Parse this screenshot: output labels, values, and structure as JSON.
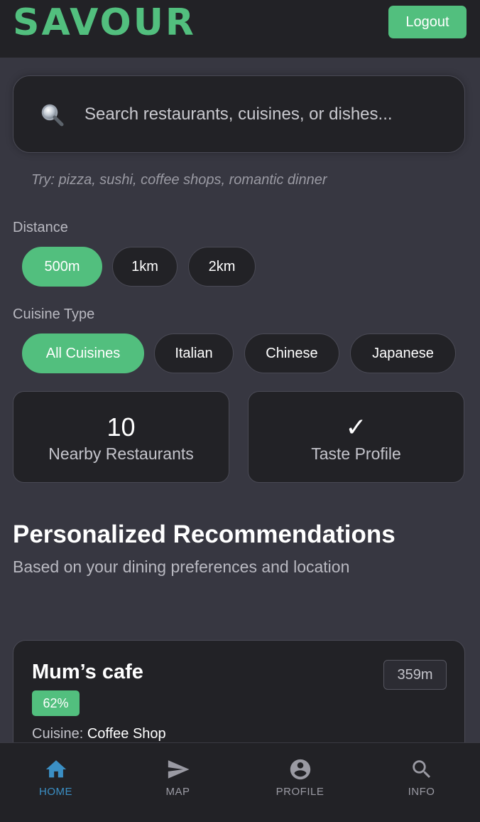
{
  "header": {
    "logo": "SAVOUR",
    "logout_label": "Logout"
  },
  "search": {
    "placeholder": "Search restaurants, cuisines, or dishes...",
    "icon": "magnifying-glass-icon",
    "hint": "Try: pizza, sushi, coffee shops, romantic dinner"
  },
  "filters": {
    "distance": {
      "label": "Distance",
      "options": [
        "500m",
        "1km",
        "2km"
      ],
      "selected": "500m"
    },
    "cuisine": {
      "label": "Cuisine Type",
      "options": [
        "All Cuisines",
        "Italian",
        "Chinese",
        "Japanese"
      ],
      "selected": "All Cuisines"
    }
  },
  "stats": [
    {
      "value": "10",
      "label": "Nearby Restaurants"
    },
    {
      "value": "✓",
      "label": "Taste Profile"
    }
  ],
  "recommendations": {
    "title": "Personalized Recommendations",
    "subtitle": "Based on your dining preferences and location",
    "items": [
      {
        "name": "Mum’s cafe",
        "distance": "359m",
        "match": "62%",
        "cuisine_label": "Cuisine:",
        "cuisine_value": "Coffee Shop"
      }
    ]
  },
  "nav": {
    "items": [
      {
        "label": "HOME",
        "icon": "home-icon",
        "active": true
      },
      {
        "label": "MAP",
        "icon": "send-icon",
        "active": false
      },
      {
        "label": "PROFILE",
        "icon": "account-circle-icon",
        "active": false
      },
      {
        "label": "INFO",
        "icon": "search-icon",
        "active": false
      }
    ]
  },
  "colors": {
    "accent": "#52bf7e",
    "background": "#373741",
    "surface": "#222226",
    "nav_active": "#3b8fc4"
  }
}
